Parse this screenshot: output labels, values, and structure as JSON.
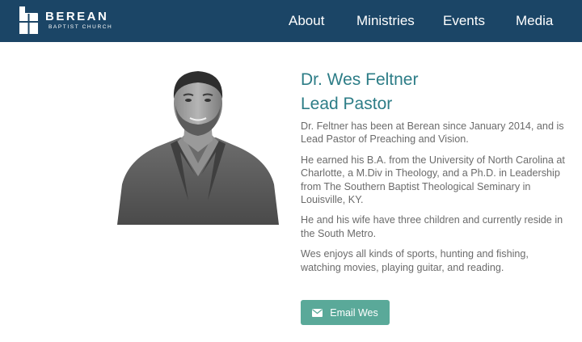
{
  "header": {
    "logo": {
      "name": "BEREAN",
      "subtitle": "BAPTIST CHURCH"
    },
    "nav": [
      {
        "label": "About"
      },
      {
        "label": "Ministries"
      },
      {
        "label": "Events"
      },
      {
        "label": "Media"
      }
    ]
  },
  "profile": {
    "name": "Dr. Wes Feltner",
    "role": "Lead Pastor",
    "bio": [
      "Dr. Feltner has been at Berean since January 2014, and is Lead Pastor of Preaching and Vision.",
      "He earned his B.A. from the University of North Carolina at Charlotte, a M.Div in Theology, and a Ph.D. in Leadership from The Southern Baptist Theological Seminary in Louisville, KY.",
      "He and his wife have three children and currently reside in the South Metro.",
      "Wes enjoys all kinds of sports, hunting and fishing, watching movies, playing guitar, and reading."
    ],
    "email_button": {
      "label": "Email Wes",
      "icon": "mail-icon"
    }
  },
  "colors": {
    "header_bg": "#1b4566",
    "title": "#2d7d87",
    "body_text": "#6b6b6b",
    "button_bg": "#5aa999"
  }
}
